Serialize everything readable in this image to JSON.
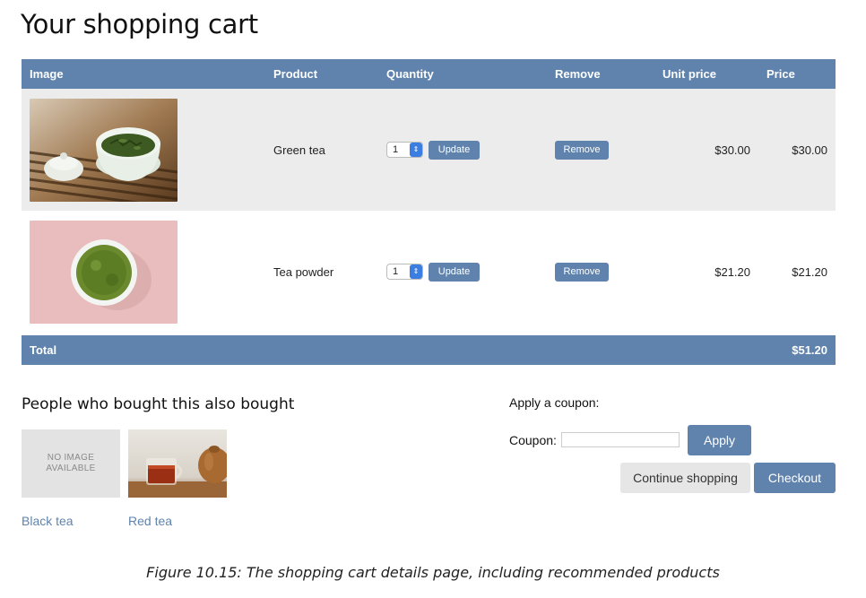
{
  "page": {
    "title": "Your shopping cart"
  },
  "cart": {
    "headers": {
      "image": "Image",
      "product": "Product",
      "quantity": "Quantity",
      "remove": "Remove",
      "unit_price": "Unit price",
      "price": "Price"
    },
    "items": [
      {
        "product": "Green tea",
        "quantity": "1",
        "update_label": "Update",
        "remove_label": "Remove",
        "unit_price": "$30.00",
        "price": "$30.00"
      },
      {
        "product": "Tea powder",
        "quantity": "1",
        "update_label": "Update",
        "remove_label": "Remove",
        "unit_price": "$21.20",
        "price": "$21.20"
      }
    ],
    "total_label": "Total",
    "total_value": "$51.20"
  },
  "recommendations": {
    "title": "People who bought this also bought",
    "no_image_text": "NO IMAGE AVAILABLE",
    "items": [
      {
        "name": "Black tea"
      },
      {
        "name": "Red tea"
      }
    ]
  },
  "coupon": {
    "title": "Apply a coupon:",
    "label": "Coupon:",
    "value": "",
    "apply_label": "Apply"
  },
  "actions": {
    "continue_label": "Continue shopping",
    "checkout_label": "Checkout"
  },
  "caption": "Figure 10.15: The shopping cart details page, including recommended products",
  "colors": {
    "accent": "#5f83ad",
    "row_alt": "#ececec",
    "link": "#5f83ad"
  }
}
